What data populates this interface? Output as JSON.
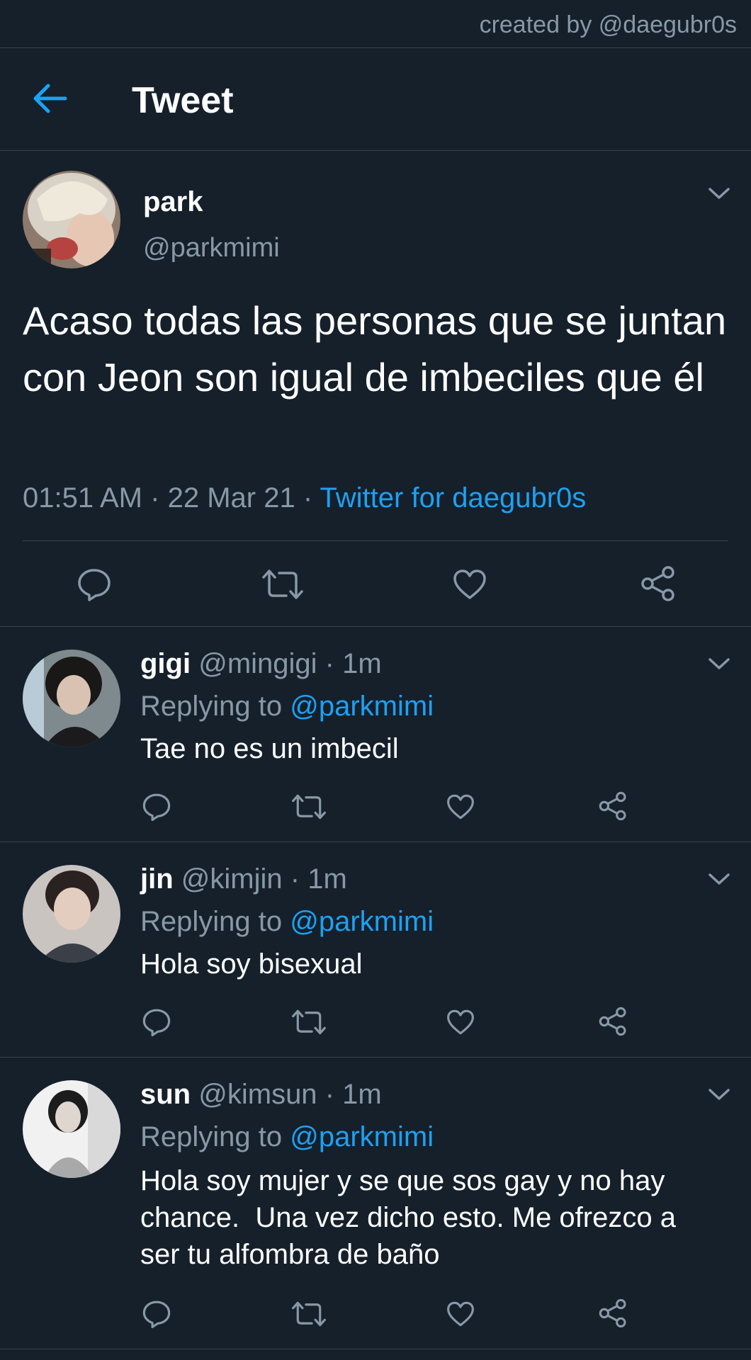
{
  "credit": "created by @daegubr0s",
  "header": {
    "title": "Tweet"
  },
  "main_tweet": {
    "name": "park",
    "handle": "@parkmimi",
    "text": "Acaso todas las personas que se juntan con Jeon son igual de imbeciles que él",
    "time": "01:51 AM",
    "date": "22 Mar 21",
    "separator": "·",
    "source": "Twitter for daegubr0s"
  },
  "replies": [
    {
      "name": "gigi",
      "handle": "@mingigi",
      "time": "1m",
      "replying_label": "Replying to",
      "replying_to": "@parkmimi",
      "text": "Tae no es un imbecil"
    },
    {
      "name": "jin",
      "handle": "@kimjin",
      "time": "1m",
      "replying_label": "Replying to",
      "replying_to": "@parkmimi",
      "text": "Hola soy bisexual"
    },
    {
      "name": "sun",
      "handle": "@kimsun",
      "time": "1m",
      "replying_label": "Replying to",
      "replying_to": "@parkmimi",
      "text": "Hola soy mujer y se que sos gay y no hay chance.  Una vez dicho esto. Me ofrezco a ser tu alfombra de baño"
    }
  ],
  "icons": {
    "back": "arrow-left-icon",
    "more": "chevron-down-icon",
    "reply": "speech-bubble-icon",
    "retweet": "retweet-icon",
    "like": "heart-icon",
    "share": "share-icon"
  },
  "colors": {
    "background": "#15202b",
    "accent": "#1da1f2",
    "muted": "#8899a6",
    "divider": "#38444d"
  }
}
